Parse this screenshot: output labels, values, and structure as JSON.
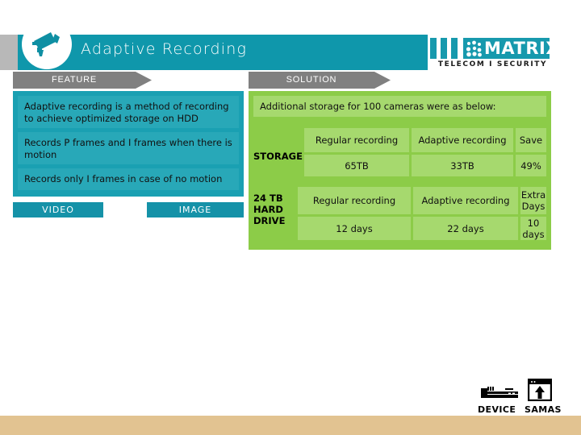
{
  "header": {
    "title": "Adaptive Recording",
    "camera_icon": "cctv-camera-icon"
  },
  "logo": {
    "word": "MATRIX",
    "tagline": "TELECOM I SECURITY",
    "dots_icon": "matrix-dots-icon",
    "accent_color": "#1799ad"
  },
  "banners": {
    "feature": "FEATURE",
    "solution": "SOLUTION"
  },
  "feature": {
    "rows": [
      "Adaptive recording is a method of recording to achieve optimized storage on HDD",
      "Records P frames and I frames when there is motion",
      "Records only I frames in case of no motion"
    ],
    "panel_color": "#1aa0b2"
  },
  "tags": {
    "video": "VIDEO",
    "image": "IMAGE"
  },
  "solution": {
    "note": "Additional storage for 100 cameras were as below:",
    "panel_color": "#8ccc48",
    "cell_color": "#a6d96e",
    "storage": {
      "label": "STORAGE",
      "headers": [
        "Regular recording",
        "Adaptive recording",
        "Save"
      ],
      "values": [
        "65TB",
        "33TB",
        "49%"
      ]
    },
    "drive": {
      "label": "24 TB HARD DRIVE",
      "label_lines": [
        "24 TB",
        "HARD",
        "DRIVE"
      ],
      "headers": [
        "Regular recording",
        "Adaptive recording",
        "Extra Days"
      ],
      "values": [
        "12 days",
        "22 days",
        "10 days"
      ]
    }
  },
  "footer": {
    "device_label": "DEVICE",
    "samas_label": "SAMAS",
    "device_icon": "dvr-device-icon",
    "samas_icon": "browser-upload-icon"
  },
  "bottom_strip_color": "#e2c391"
}
